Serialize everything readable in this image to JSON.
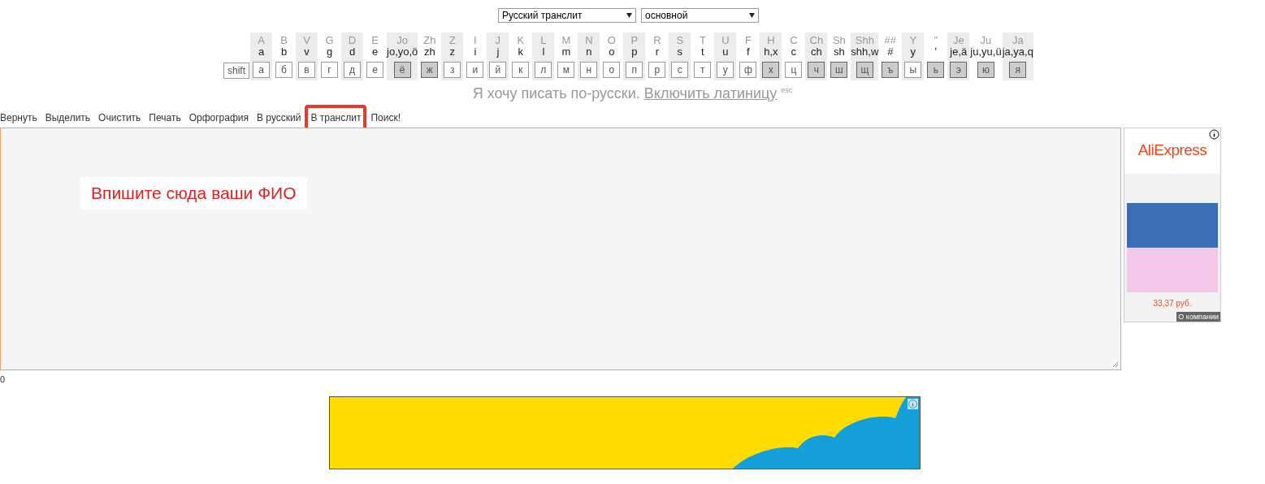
{
  "selects": [
    {
      "value": "Русский транслит"
    },
    {
      "value": "основной"
    }
  ],
  "keyboard": {
    "shift": "shift",
    "keys": [
      {
        "upper": "A",
        "lower": "a",
        "key": "а",
        "highlighted": false
      },
      {
        "upper": "B",
        "lower": "b",
        "key": "б",
        "highlighted": false
      },
      {
        "upper": "V",
        "lower": "v",
        "key": "в",
        "highlighted": false
      },
      {
        "upper": "G",
        "lower": "g",
        "key": "г",
        "highlighted": false
      },
      {
        "upper": "D",
        "lower": "d",
        "key": "д",
        "highlighted": false
      },
      {
        "upper": "E",
        "lower": "e",
        "key": "е",
        "highlighted": false
      },
      {
        "upper": "Jo",
        "lower": "jo,yo,ö",
        "key": "ё",
        "highlighted": true
      },
      {
        "upper": "Zh",
        "lower": "zh",
        "key": "ж",
        "highlighted": true
      },
      {
        "upper": "Z",
        "lower": "z",
        "key": "з",
        "highlighted": false
      },
      {
        "upper": "I",
        "lower": "i",
        "key": "и",
        "highlighted": false
      },
      {
        "upper": "J",
        "lower": "j",
        "key": "й",
        "highlighted": false
      },
      {
        "upper": "K",
        "lower": "k",
        "key": "к",
        "highlighted": false
      },
      {
        "upper": "L",
        "lower": "l",
        "key": "л",
        "highlighted": false
      },
      {
        "upper": "M",
        "lower": "m",
        "key": "м",
        "highlighted": false
      },
      {
        "upper": "N",
        "lower": "n",
        "key": "н",
        "highlighted": false
      },
      {
        "upper": "O",
        "lower": "o",
        "key": "о",
        "highlighted": false
      },
      {
        "upper": "P",
        "lower": "p",
        "key": "п",
        "highlighted": false
      },
      {
        "upper": "R",
        "lower": "r",
        "key": "р",
        "highlighted": false
      },
      {
        "upper": "S",
        "lower": "s",
        "key": "с",
        "highlighted": false
      },
      {
        "upper": "T",
        "lower": "t",
        "key": "т",
        "highlighted": false
      },
      {
        "upper": "U",
        "lower": "u",
        "key": "у",
        "highlighted": false
      },
      {
        "upper": "F",
        "lower": "f",
        "key": "ф",
        "highlighted": false
      },
      {
        "upper": "H",
        "lower": "h,x",
        "key": "х",
        "highlighted": true
      },
      {
        "upper": "C",
        "lower": "c",
        "key": "ц",
        "highlighted": false
      },
      {
        "upper": "Ch",
        "lower": "ch",
        "key": "ч",
        "highlighted": true
      },
      {
        "upper": "Sh",
        "lower": "sh",
        "key": "ш",
        "highlighted": true
      },
      {
        "upper": "Shh",
        "lower": "shh,w",
        "key": "щ",
        "highlighted": true
      },
      {
        "upper": "##",
        "lower": "#",
        "key": "ъ",
        "highlighted": true
      },
      {
        "upper": "Y",
        "lower": "y",
        "key": "ы",
        "highlighted": false
      },
      {
        "upper": "\"",
        "lower": "'",
        "key": "ь",
        "highlighted": true
      },
      {
        "upper": "Je",
        "lower": "je,ä",
        "key": "э",
        "highlighted": true
      },
      {
        "upper": "Ju",
        "lower": "ju,yu,ü",
        "key": "ю",
        "highlighted": true
      },
      {
        "upper": "Ja",
        "lower": "ja,ya,q",
        "key": "я",
        "highlighted": true
      }
    ]
  },
  "mode": {
    "text": "Я хочу писать по-русски.",
    "link": "Включить латиницу",
    "hint": "esc"
  },
  "toolbar": [
    {
      "label": "Вернуть",
      "highlighted": false
    },
    {
      "label": "Выделить",
      "highlighted": false
    },
    {
      "label": "Очистить",
      "highlighted": false
    },
    {
      "label": "Печать",
      "highlighted": false
    },
    {
      "label": "Орфография",
      "highlighted": false
    },
    {
      "label": "В русский",
      "highlighted": false
    },
    {
      "label": "В транслит",
      "highlighted": true
    },
    {
      "label": "Поиск!",
      "highlighted": false
    }
  ],
  "editor": {
    "callout": "Впишите сюда ваши ФИО"
  },
  "counter": "0",
  "side_ad": {
    "brand": "AliExpress",
    "price": "33,37 руб.",
    "about": "О компании"
  }
}
